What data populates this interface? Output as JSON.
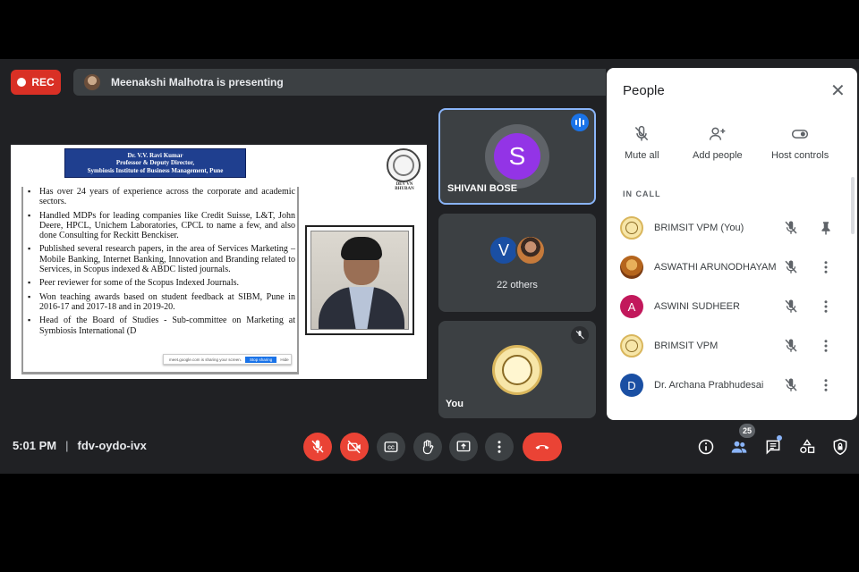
{
  "top_bar": {
    "rec_label": "REC",
    "presenting_text": "Meenakshi Malhotra is presenting"
  },
  "slide": {
    "header_lines": [
      "Dr. V.V. Ravi Kumar",
      "Professor & Deputy Director,",
      "Symbiosis Institute of Business Management, Pune"
    ],
    "logo_text": "DEV VN BHUBAN",
    "bullets": [
      "Has over 24 years of experience across the corporate and academic sectors.",
      "Handled MDPs for leading companies like Credit Suisse, L&T, John Deere, HPCL, Unichem Laboratories, CPCL to name a few, and also done Consulting for Reckitt Benckiser.",
      "Published several research papers, in the area of Services Marketing – Mobile Banking, Internet Banking, Innovation and Branding related to Services, in Scopus indexed & ABDC listed journals.",
      "Peer reviewer for some of the Scopus Indexed Journals.",
      "Won teaching awards based on student feedback at SIBM, Pune in 2016-17 and 2017-18 and in 2019-20.",
      "Head of the Board of Studies - Sub-committee on Marketing at Symbiosis International (D"
    ],
    "share_bar_text": "meet.google.com is sharing your screen.",
    "share_bar_stop": "Stop sharing",
    "share_bar_hide": "Hide"
  },
  "tiles": {
    "shivani": {
      "initial": "S",
      "name": "SHIVANI BOSE"
    },
    "others": {
      "initial": "V",
      "label": "22 others"
    },
    "you": {
      "name": "You"
    }
  },
  "people": {
    "title": "People",
    "actions": [
      {
        "label": "Mute all",
        "icon": "mic-off-icon"
      },
      {
        "label": "Add people",
        "icon": "add-person-icon"
      },
      {
        "label": "Host controls",
        "icon": "toggle-icon"
      }
    ],
    "section_label": "IN CALL",
    "participants": [
      {
        "name": "BRIMSIT VPM (You)",
        "avatar": "logo",
        "initial": ""
      },
      {
        "name": "ASWATHI ARUNODHAYAM",
        "avatar": "goddess",
        "initial": ""
      },
      {
        "name": "ASWINI SUDHEER",
        "avatar": "letter",
        "initial": "A",
        "color": "#c2185b"
      },
      {
        "name": "BRIMSIT VPM",
        "avatar": "logo",
        "initial": ""
      },
      {
        "name": "Dr. Archana Prabhudesai",
        "avatar": "letter",
        "initial": "D",
        "color": "#1a4fa3"
      }
    ]
  },
  "bottom_bar": {
    "time": "5:01 PM",
    "separator": "|",
    "meeting_code": "fdv-oydo-ivx",
    "participant_count": "25"
  },
  "colors": {
    "background": "#202124",
    "tile": "#3c4043",
    "danger": "#ea4335",
    "active_border": "#8ab4f8"
  }
}
